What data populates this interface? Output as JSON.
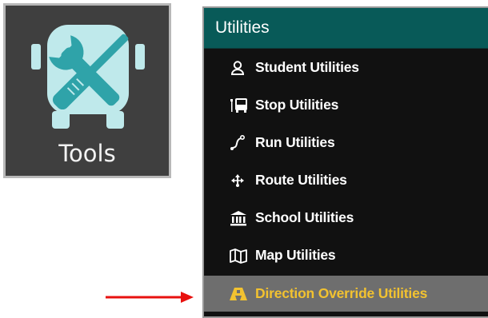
{
  "tile": {
    "label": "Tools",
    "icon": "bus-tools-icon"
  },
  "menu": {
    "title": "Utilities",
    "items": [
      {
        "label": "Student Utilities",
        "icon": "user-icon"
      },
      {
        "label": "Stop Utilities",
        "icon": "bus-stop-icon"
      },
      {
        "label": "Run Utilities",
        "icon": "run-path-icon"
      },
      {
        "label": "Route Utilities",
        "icon": "route-arrows-icon"
      },
      {
        "label": "School Utilities",
        "icon": "school-building-icon"
      },
      {
        "label": "Map Utilities",
        "icon": "map-icon"
      },
      {
        "label": "Direction Override Utilities",
        "icon": "direction-sign-icon"
      }
    ],
    "active_color": "#f2c230",
    "header_color": "#085a58"
  },
  "annotation": {
    "arrow_color": "#e8110f",
    "arrow": "red-arrow-pointer"
  }
}
